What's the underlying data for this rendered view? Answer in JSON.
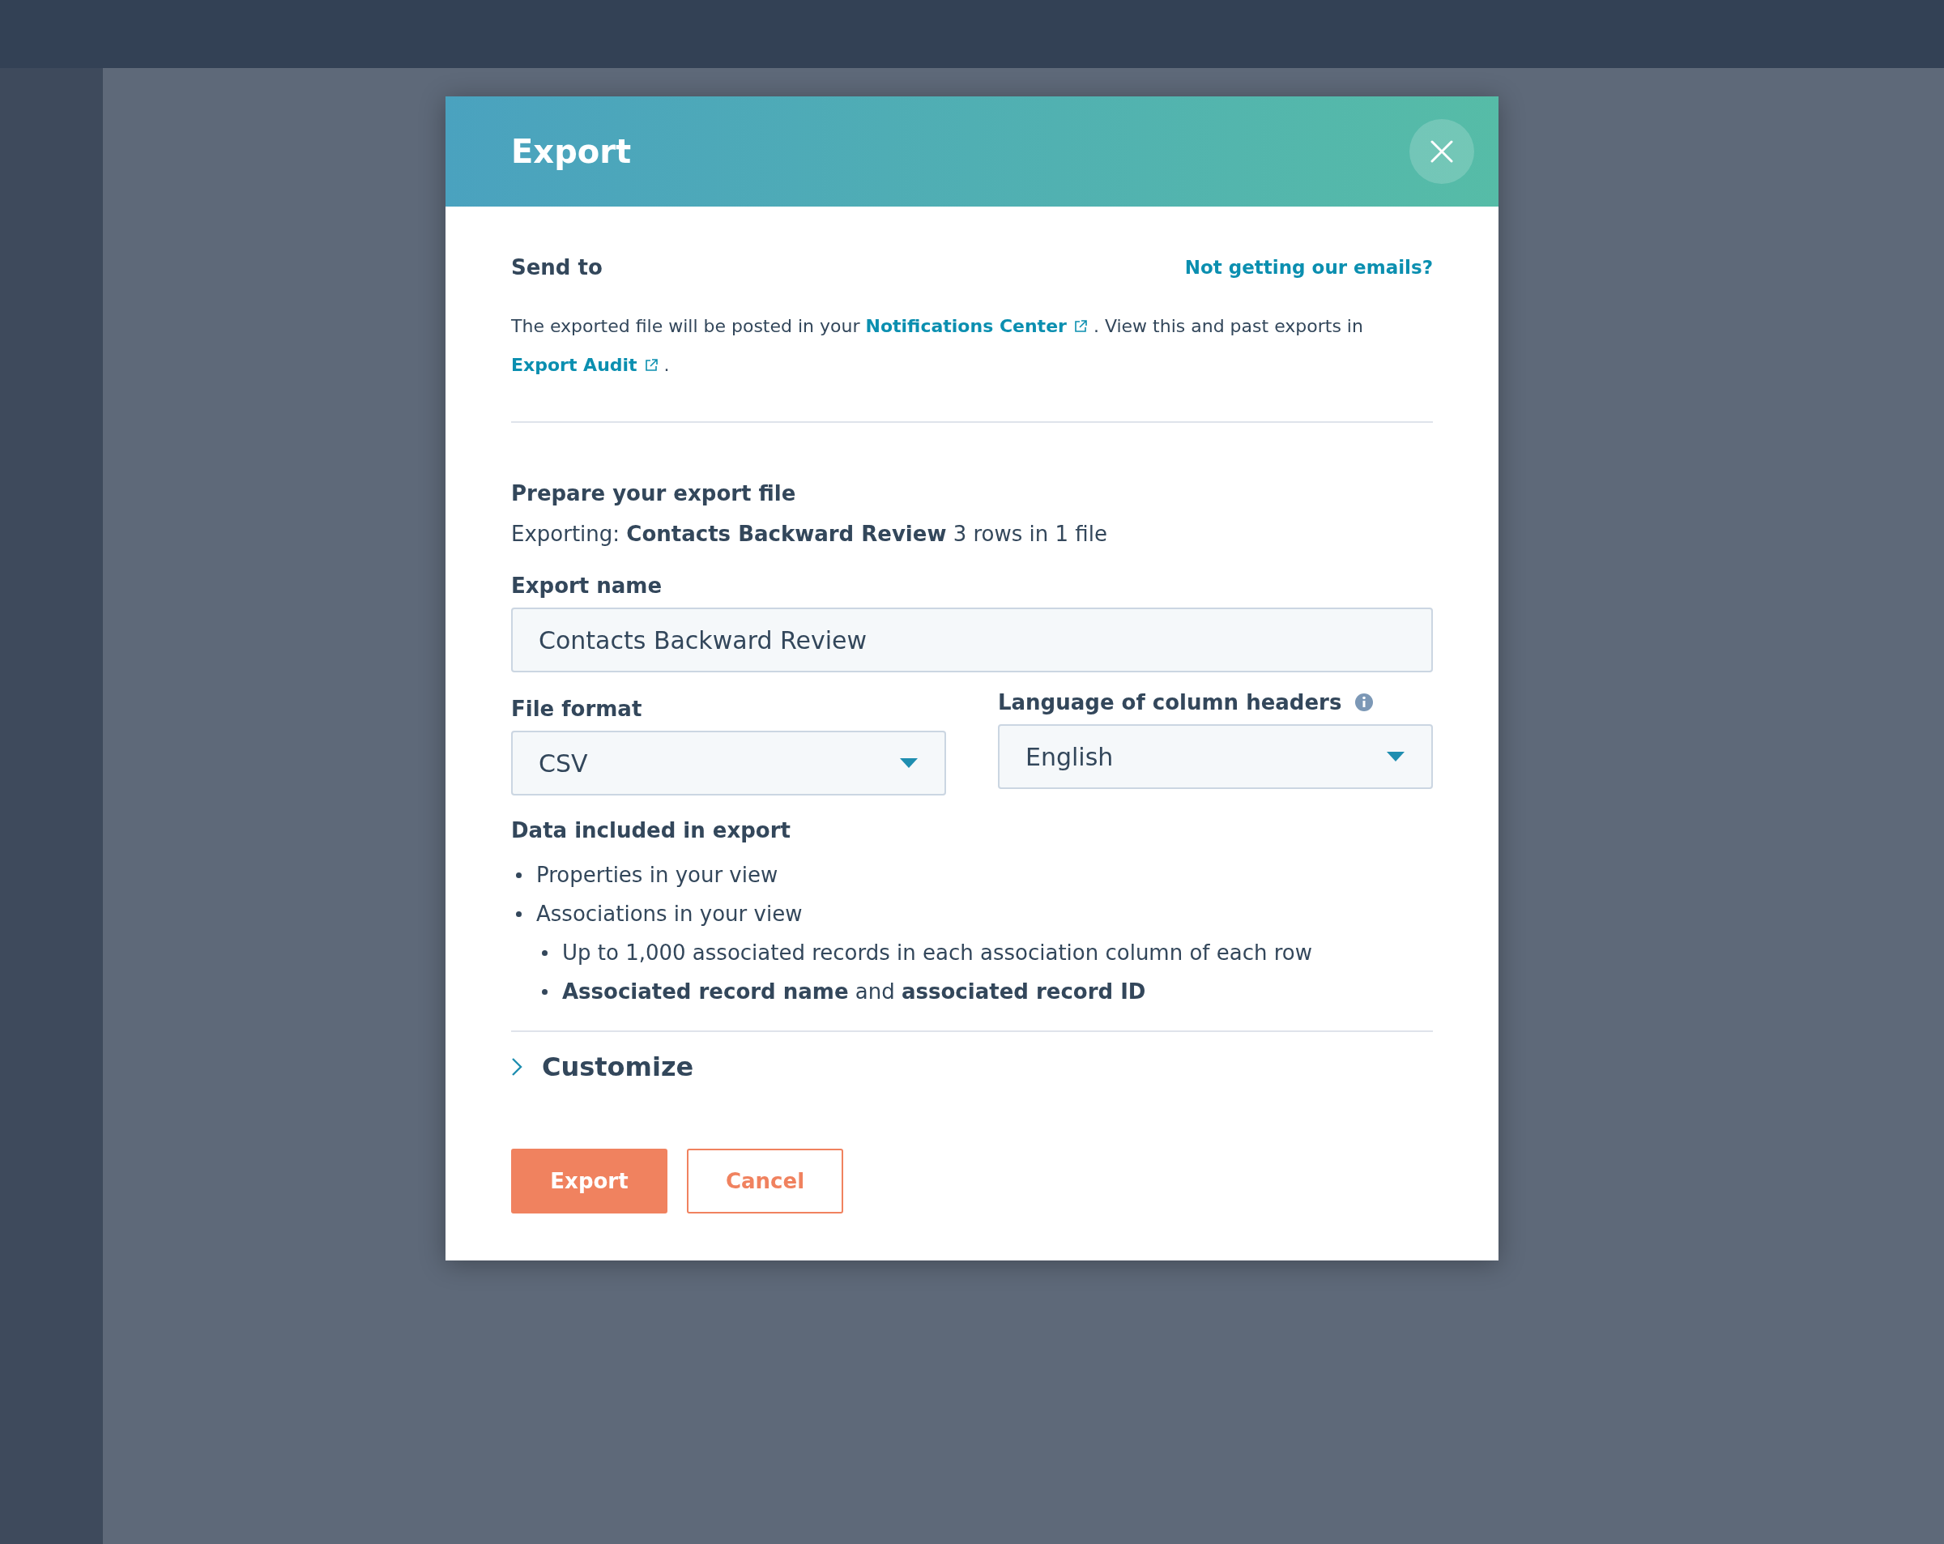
{
  "modal": {
    "title": "Export",
    "send_to": {
      "heading": "Send to",
      "help_link": "Not getting our emails?",
      "description": [
        {
          "kind": "text",
          "text": "The exported file will be posted in your"
        },
        {
          "kind": "link",
          "text": "Notifications Center"
        },
        {
          "kind": "text",
          "text": ". View this and past exports in"
        },
        {
          "kind": "link",
          "text": "Export Audit"
        },
        {
          "kind": "text",
          "text": "."
        }
      ]
    },
    "prepare": {
      "heading": "Prepare your export file",
      "summary": "Exporting: **Contacts Backward Review**  3 rows in 1 file",
      "export_name": {
        "label": "Export name",
        "value": "Contacts Backward Review"
      },
      "file_format": {
        "label": "File format",
        "value": "CSV"
      },
      "language": {
        "label": "Language of column headers",
        "value": "English"
      }
    },
    "data_included": {
      "heading": "Data included in export",
      "items": [
        {
          "text": "Properties in your view"
        },
        {
          "text": "Associations in your view",
          "children": [
            {
              "text": "Up to 1,000 associated records in each association column of each row"
            },
            {
              "text": "**Associated record name** and **associated record ID**"
            }
          ]
        }
      ]
    },
    "customize": {
      "label": "Customize",
      "expanded": false
    },
    "buttons": [
      {
        "kind": "primary",
        "label": "Export"
      },
      {
        "kind": "secondary",
        "label": "Cancel"
      }
    ]
  }
}
